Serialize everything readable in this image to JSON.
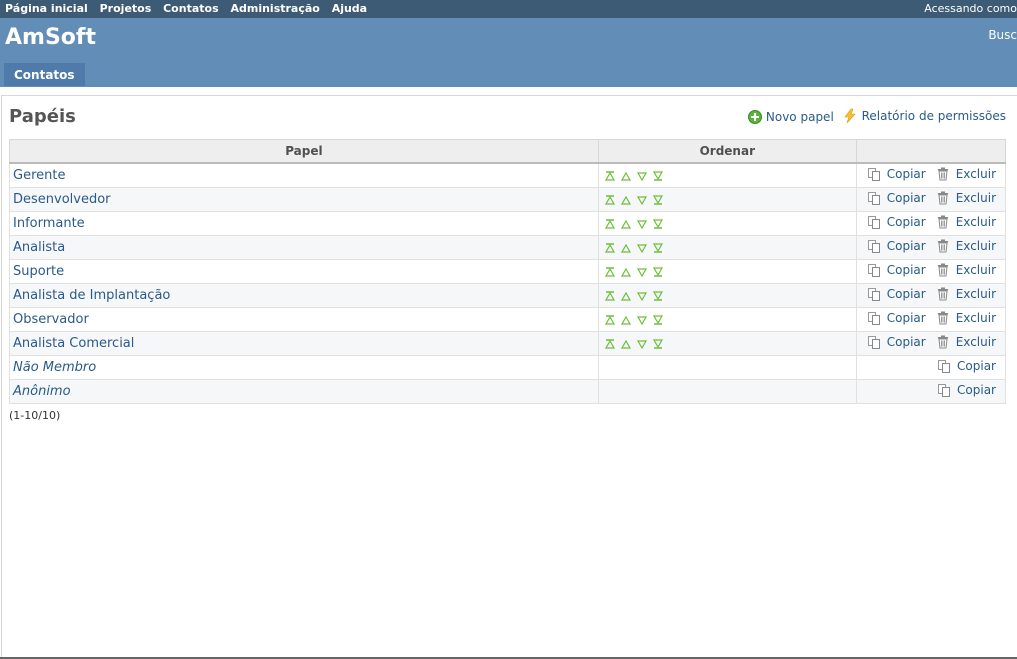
{
  "top_menu": {
    "links": [
      "Página inicial",
      "Projetos",
      "Contatos",
      "Administração",
      "Ajuda"
    ],
    "logged_as": "Acessando como"
  },
  "header": {
    "title": "AmSoft",
    "search_label": "Busc",
    "tab": "Contatos"
  },
  "page": {
    "title": "Papéis",
    "new_role": "Novo papel",
    "permissions_report": "Relatório de permissões"
  },
  "table": {
    "columns": [
      "Papel",
      "Ordenar",
      ""
    ],
    "rows": [
      {
        "name": "Gerente",
        "builtin": false,
        "actions": [
          "Copiar",
          "Excluir"
        ]
      },
      {
        "name": "Desenvolvedor",
        "builtin": false,
        "actions": [
          "Copiar",
          "Excluir"
        ]
      },
      {
        "name": "Informante",
        "builtin": false,
        "actions": [
          "Copiar",
          "Excluir"
        ]
      },
      {
        "name": "Analista",
        "builtin": false,
        "actions": [
          "Copiar",
          "Excluir"
        ]
      },
      {
        "name": "Suporte",
        "builtin": false,
        "actions": [
          "Copiar",
          "Excluir"
        ]
      },
      {
        "name": "Analista de Implantação",
        "builtin": false,
        "actions": [
          "Copiar",
          "Excluir"
        ]
      },
      {
        "name": "Observador",
        "builtin": false,
        "actions": [
          "Copiar",
          "Excluir"
        ]
      },
      {
        "name": "Analista Comercial",
        "builtin": false,
        "actions": [
          "Copiar",
          "Excluir"
        ]
      },
      {
        "name": "Não Membro",
        "builtin": true,
        "actions": [
          "Copiar"
        ]
      },
      {
        "name": "Anônimo",
        "builtin": true,
        "actions": [
          "Copiar"
        ]
      }
    ]
  },
  "pagination": "(1-10/10)",
  "icons": {
    "sorter": [
      "move-top-icon",
      "move-up-icon",
      "move-down-icon",
      "move-bottom-icon"
    ],
    "copy": "copy-icon",
    "delete": "trash-icon",
    "add": "add-icon",
    "report": "lightning-icon"
  },
  "colors": {
    "top_menu_bg": "#3e5b76",
    "header_bg": "#628db6",
    "tab_bg": "#507aaa",
    "link": "#2a5a8a",
    "sorter_green": "#6dbf3a"
  }
}
